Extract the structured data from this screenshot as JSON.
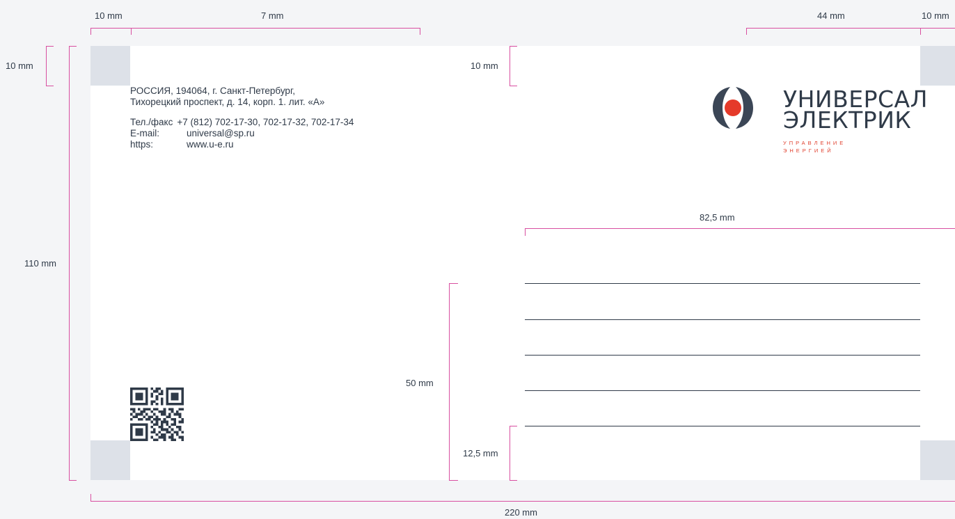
{
  "dimensions": {
    "left_margin": "10 mm",
    "text_width": "7 mm",
    "logo_width": "44 mm",
    "right_margin": "10 mm",
    "top_margin_left": "10 mm",
    "top_margin_right": "10 mm",
    "height": "110 mm",
    "lines_width": "82,5 mm",
    "lines_block": "50 mm",
    "bottom_margin": "12,5 mm",
    "width": "220 mm"
  },
  "sender": {
    "address_line1": "РОССИЯ, 194064, г. Санкт-Петербург,",
    "address_line2": "Тихорецкий проспект, д. 14, корп. 1. лит. «А»",
    "phone_label": "Тел./факс",
    "phone_value": "+7 (812) 702-17-30, 702-17-32, 702-17-34",
    "email_label": "E-mail:",
    "email_value": "universal@sp.ru",
    "web_label": "https:",
    "web_value": "www.u-e.ru"
  },
  "logo": {
    "line1": "УНИВЕРСАЛ",
    "line2": "ЭЛЕКТРИК",
    "tagline1": "УПРАВЛЕНИЕ",
    "tagline2": "ЭНЕРГИЕЙ",
    "icon": "logo-icon"
  },
  "colors": {
    "background": "#f4f5f7",
    "envelope": "#ffffff",
    "corner_marks": "#dde1e8",
    "dimension_lines": "#d84ea0",
    "text": "#2f3a48",
    "accent": "#e0402e"
  }
}
